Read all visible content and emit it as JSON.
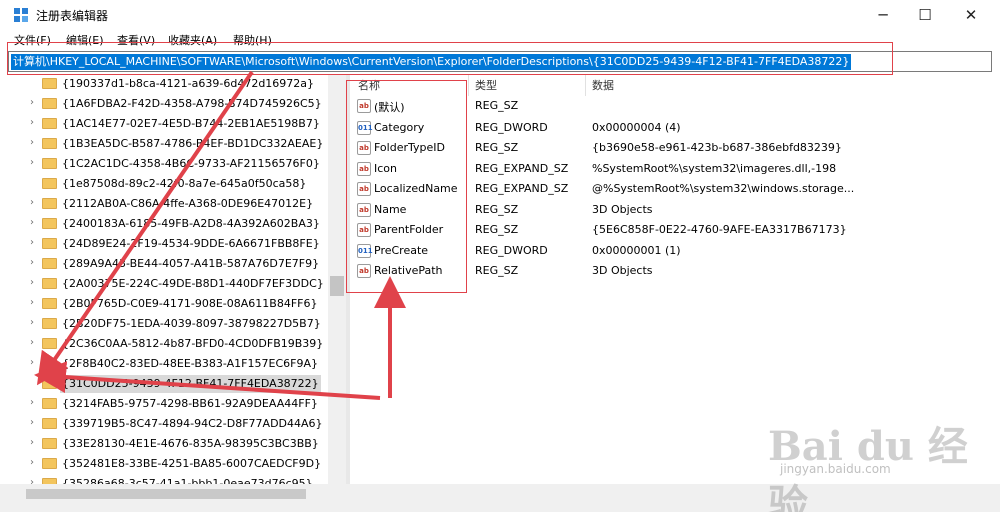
{
  "window": {
    "title": "注册表编辑器",
    "minimize": "─",
    "maximize": "☐",
    "close": "✕"
  },
  "menu": [
    "文件(F)",
    "编辑(E)",
    "查看(V)",
    "收藏夹(A)",
    "帮助(H)"
  ],
  "address": "计算机\\HKEY_LOCAL_MACHINE\\SOFTWARE\\Microsoft\\Windows\\CurrentVersion\\Explorer\\FolderDescriptions\\{31C0DD25-9439-4F12-BF41-7FF4EDA38722}",
  "tree": {
    "items": [
      "{190337d1-b8ca-4121-a639-6d472d16972a}",
      "{1A6FDBA2-F42D-4358-A798-B74D745926C5}",
      "{1AC14E77-02E7-4E5D-B744-2EB1AE5198B7}",
      "{1B3EA5DC-B587-4786-B4EF-BD1DC332AEAE}",
      "{1C2AC1DC-4358-4B6C-9733-AF21156576F0}",
      "{1e87508d-89c2-42f0-8a7e-645a0f50ca58}",
      "{2112AB0A-C86A-4ffe-A368-0DE96E47012E}",
      "{2400183A-6185-49FB-A2D8-4A392A602BA3}",
      "{24D89E24-2F19-4534-9DDE-6A6671FBB8FE}",
      "{289A9A43-BE44-4057-A41B-587A76D7E7F9}",
      "{2A00375E-224C-49DE-B8D1-440DF7EF3DDC}",
      "{2B0F765D-C0E9-4171-908E-08A611B84FF6}",
      "{2B20DF75-1EDA-4039-8097-38798227D5B7}",
      "{2C36C0AA-5812-4b87-BFD0-4CD0DFB19B39}",
      "{2F8B40C2-83ED-48EE-B383-A1F157EC6F9A}",
      "{31C0DD25-9439-4F12-BF41-7FF4EDA38722}",
      "{3214FAB5-9757-4298-BB61-92A9DEAA44FF}",
      "{339719B5-8C47-4894-94C2-D8F77ADD44A6}",
      "{33E28130-4E1E-4676-835A-98395C3BC3BB}",
      "{352481E8-33BE-4251-BA85-6007CAEDCF9D}",
      "{35286a68-3c57-41a1-bbb1-0eae73d76c95}"
    ]
  },
  "values": {
    "headers": {
      "name": "名称",
      "type": "类型",
      "data": "数据"
    },
    "rows": [
      {
        "icon": "string-value-icon",
        "name": "(默认)",
        "type": "REG_SZ",
        "data": ""
      },
      {
        "icon": "dword-value-icon",
        "name": "Category",
        "type": "REG_DWORD",
        "data": "0x00000004 (4)"
      },
      {
        "icon": "string-value-icon",
        "name": "FolderTypeID",
        "type": "REG_SZ",
        "data": "{b3690e58-e961-423b-b687-386ebfd83239}"
      },
      {
        "icon": "string-value-icon",
        "name": "Icon",
        "type": "REG_EXPAND_SZ",
        "data": "%SystemRoot%\\system32\\imageres.dll,-198"
      },
      {
        "icon": "string-value-icon",
        "name": "LocalizedName",
        "type": "REG_EXPAND_SZ",
        "data": "@%SystemRoot%\\system32\\windows.storage..."
      },
      {
        "icon": "string-value-icon",
        "name": "Name",
        "type": "REG_SZ",
        "data": "3D Objects"
      },
      {
        "icon": "string-value-icon",
        "name": "ParentFolder",
        "type": "REG_SZ",
        "data": "{5E6C858F-0E22-4760-9AFE-EA3317B67173}"
      },
      {
        "icon": "dword-value-icon",
        "name": "PreCreate",
        "type": "REG_DWORD",
        "data": "0x00000001 (1)"
      },
      {
        "icon": "string-value-icon",
        "name": "RelativePath",
        "type": "REG_SZ",
        "data": "3D Objects"
      }
    ]
  },
  "icon_labels": {
    "string": "ab",
    "dword": "011"
  },
  "watermark": {
    "main": "Bai du 经验",
    "sub": "jingyan.baidu.com"
  },
  "colors": {
    "annotation": "#e0424a",
    "selection": "#0078d7",
    "folder": "#f3c55d"
  }
}
